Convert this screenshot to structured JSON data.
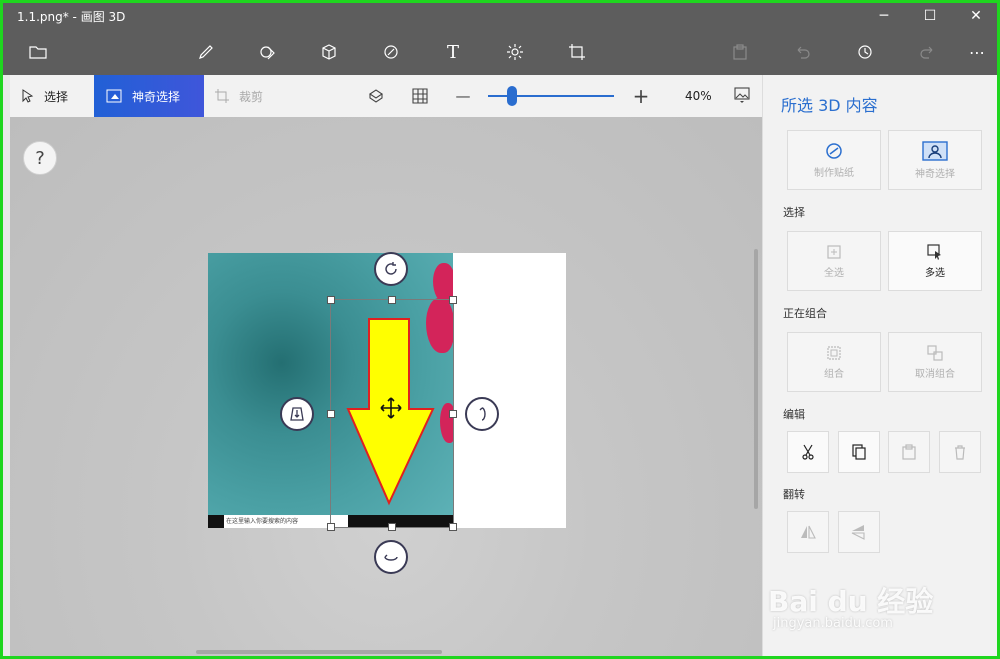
{
  "window": {
    "title": "1.1.png* - 画图 3D",
    "minimize": "─",
    "maximize": "☐",
    "close": "✕"
  },
  "toolbar": {
    "menu_icon": "folder-icon",
    "tools": [
      {
        "name": "brushes-icon",
        "glyph": "🖌"
      },
      {
        "name": "2d-shapes-icon",
        "glyph": "◇"
      },
      {
        "name": "3d-shapes-icon",
        "glyph": "⬡"
      },
      {
        "name": "stickers-icon",
        "glyph": "◈"
      },
      {
        "name": "text-icon",
        "glyph": "T"
      },
      {
        "name": "effects-icon",
        "glyph": "☼"
      },
      {
        "name": "canvas-icon",
        "glyph": "⌗"
      }
    ],
    "right": [
      {
        "name": "paste-icon",
        "glyph": "▣",
        "dim": true
      },
      {
        "name": "undo-icon",
        "glyph": "↶",
        "dim": true
      },
      {
        "name": "history-icon",
        "glyph": "↻",
        "dim": false
      },
      {
        "name": "redo-icon",
        "glyph": "↷",
        "dim": true
      },
      {
        "name": "more-icon",
        "glyph": "⋯",
        "dim": false
      }
    ]
  },
  "subbar": {
    "select_label": "选择",
    "magic_select_label": "神奇选择",
    "crop_label": "裁剪",
    "zoom_value": "40%",
    "zoom_fraction": 0.17,
    "minus": "—",
    "plus": "+"
  },
  "canvas": {
    "help": "?",
    "taskbar_search_text": "在这里输入你要搜索的内容"
  },
  "panel": {
    "title": "所选 3D 内容",
    "top_buttons": [
      {
        "label": "制作贴纸",
        "icon": "sticker-icon"
      },
      {
        "label": "神奇选择",
        "icon": "magic-select-icon"
      }
    ],
    "select_heading": "选择",
    "select_buttons": [
      {
        "label": "全选",
        "icon": "select-all-icon"
      },
      {
        "label": "多选",
        "icon": "multi-select-icon"
      }
    ],
    "group_heading": "正在组合",
    "group_buttons": [
      {
        "label": "组合",
        "icon": "group-icon"
      },
      {
        "label": "取消组合",
        "icon": "ungroup-icon"
      }
    ],
    "edit_heading": "编辑",
    "flip_heading": "翻转"
  },
  "watermark": {
    "brand": "Bai du 经验",
    "url": "jingyan.baidu.com"
  }
}
